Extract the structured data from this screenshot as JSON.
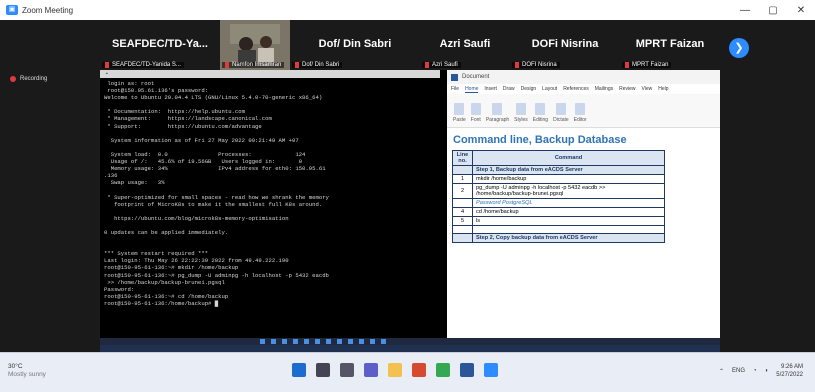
{
  "window": {
    "title": "Zoom Meeting",
    "controls": [
      "—",
      "▢",
      "✕"
    ]
  },
  "participants": [
    {
      "name": "SEAFDEC/TD-Ya...",
      "caption": "SEAFDEC/TD-Yanida S..."
    },
    {
      "name": "",
      "caption": "Namfon Imsamran"
    },
    {
      "name": "Dof/ Din Sabri",
      "caption": "Dof/ Din Sabri"
    },
    {
      "name": "Azri Saufi",
      "caption": "Azri Saufi"
    },
    {
      "name": "DOFi Nisrina",
      "caption": "DOFI Nisrina"
    },
    {
      "name": "MPRT Faizan",
      "caption": "MPRT Faizan"
    }
  ],
  "next_icon": "chevron-right-icon",
  "recording": {
    "label": "Recording"
  },
  "terminal": {
    "lines": [
      " login as: root",
      " root@150.95.61.136's password:",
      "Welcome to Ubuntu 20.04.4 LTS (GNU/Linux 5.4.0-70-generic x86_64)",
      "",
      " * Documentation:  https://help.ubuntu.com",
      " * Management:     https://landscape.canonical.com",
      " * Support:        https://ubuntu.com/advantage",
      "",
      "  System information as of Fri 27 May 2022 09:21:49 AM +07",
      "",
      "  System load:  0.0               Processes:             124",
      "  Usage of /:   45.6% of 19.56GB   Users logged in:       0",
      "  Memory usage: 34%               IPv4 address for eth0: 150.95.61",
      ".136",
      "  Swap usage:   3%",
      "",
      " * Super-optimized for small spaces - read how we shrank the memory",
      "   footprint of MicroK8s to make it the smallest full K8s around.",
      "",
      "   https://ubuntu.com/blog/microk8s-memory-optimisation",
      "",
      "0 updates can be applied immediately.",
      "",
      "",
      "*** System restart required ***",
      "Last login: Thu May 26 22:22:39 2022 from 49.49.222.190",
      "root@150-95-61-136:~# mkdir /home/backup",
      "root@150-95-61-136:~# pg_dump -U adminpg -h localhost -p 5432 eacdb",
      " >> /home/backup/backup-brunei.pgsql",
      "Password:",
      "root@150-95-61-136:~# cd /home/backup",
      "root@150-95-61-136:/home/backup# █"
    ]
  },
  "word": {
    "title": "Document",
    "tabs": [
      "File",
      "Home",
      "Insert",
      "Draw",
      "Design",
      "Layout",
      "References",
      "Mailings",
      "Review",
      "View",
      "Help"
    ],
    "ribbon": [
      "Paste",
      "Font",
      "Paragraph",
      "Styles",
      "Editing",
      "Dictate",
      "Editor"
    ],
    "heading": "Command line, Backup Database",
    "col_no": "Line no.",
    "col_cmd": "Command",
    "rows": [
      {
        "no": "",
        "cmd": "Step 1, Backup data from eACDS Server",
        "kind": "step"
      },
      {
        "no": "1",
        "cmd": "mkdir /home/backup",
        "kind": "cmd"
      },
      {
        "no": "2",
        "cmd": "pg_dump -U adminpg -h localhost -p 5432 eacdb >> /home/backup/backup-brunei.pgsql",
        "kind": "cmd"
      },
      {
        "no": "",
        "cmd": "Password PostgreSQL",
        "kind": "sub"
      },
      {
        "no": "4",
        "cmd": "cd /home/backup",
        "kind": "cmd"
      },
      {
        "no": "5",
        "cmd": "ls",
        "kind": "cmd"
      },
      {
        "no": "",
        "cmd": "",
        "kind": "cmd"
      },
      {
        "no": "",
        "cmd": "Step 2, Copy backup data from eACDS Server",
        "kind": "step"
      }
    ],
    "status": [
      "Page 1 of 6",
      "1 of 327 words",
      "English",
      "Focus"
    ]
  },
  "taskbar": {
    "weather_temp": "30°C",
    "weather_desc": "Mostly sunny",
    "time": "9:26 AM",
    "date": "5/27/2022",
    "lang": "ENG"
  }
}
